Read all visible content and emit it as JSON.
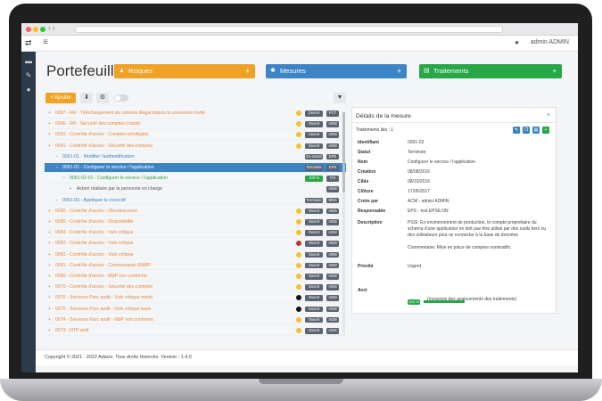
{
  "app": {
    "menu_icon": "hamburger-icon",
    "user_name": "admin ADMIN"
  },
  "page": {
    "title": "Portefeuille"
  },
  "categories": [
    {
      "label": "Risques",
      "color": "#f0a226",
      "icon": "warning-icon"
    },
    {
      "label": "Mesures",
      "color": "#3c84c6",
      "icon": "cogs-icon"
    },
    {
      "label": "Traitements",
      "color": "#27a745",
      "icon": "list-icon"
    }
  ],
  "toolbar": {
    "add_label": "+ Ajouter"
  },
  "tree": [
    {
      "text": "0097 - RR : Téléchargement de contenu illégal depuis la connexion invité",
      "color": "#e8883a",
      "indent": 0,
      "dot": "#f2c230",
      "badges": [
        "Ouvert",
        "PCT"
      ]
    },
    {
      "text": "0096 - RR : Sécurité des comptes (copie)",
      "color": "#e8883a",
      "indent": 0,
      "dot": "#f2c230",
      "badges": [
        "Ouvert",
        "ADM"
      ]
    },
    {
      "text": "0092 - Contrôle d'accès - Comptes privilégiés",
      "color": "#e8883a",
      "indent": 0,
      "dot": "#f2c230",
      "badges": [
        "Ouvert",
        "ADM"
      ]
    },
    {
      "text": "0091 - Contrôle d'accès - Sécurité des comptes",
      "color": "#e8883a",
      "indent": 0,
      "dot": "#f2c230",
      "badges": [
        "Ouvert",
        "ADM"
      ]
    },
    {
      "text": "0091-01 - Modifier l'authentification",
      "color": "#3c84c6",
      "indent": 1,
      "dot": "",
      "badges": [
        "En retard",
        "EPS"
      ]
    },
    {
      "text": "0091-02 - Configurer le service / l'application",
      "color": "#ffffff",
      "indent": 1,
      "dot": "",
      "badges": [
        "Terminée",
        "EPS"
      ],
      "selected": true
    },
    {
      "text": "0091-02-01 - Configurer le service / l'application",
      "color": "#27a745",
      "indent": 2,
      "dot": "",
      "badges": [
        "100 %",
        "THI"
      ]
    },
    {
      "text": "Action réalisée par la personne en charge",
      "color": "#555555",
      "indent": 3,
      "dot": "",
      "badges": [
        "ADM"
      ]
    },
    {
      "text": "0091-03 - Appliquer le correctif",
      "color": "#3c84c6",
      "indent": 1,
      "dot": "",
      "badges": [
        "Terminée",
        "BRO"
      ]
    },
    {
      "text": "0090 - Contrôle d'accès - Obsolescence",
      "color": "#e8883a",
      "indent": 0,
      "dot": "#f2c230",
      "badges": [
        "Ouvert",
        "ADM"
      ]
    },
    {
      "text": "0085 - Contrôle d'accès - Disponibilité",
      "color": "#e8883a",
      "indent": 0,
      "dot": "#f2c230",
      "badges": [
        "Ouvert",
        "ADM"
      ]
    },
    {
      "text": "0084 - Contrôle d'accès - Vuln critique",
      "color": "#e8883a",
      "indent": 0,
      "dot": "#f2c230",
      "badges": [
        "Ouvert",
        "ADM"
      ]
    },
    {
      "text": "0083 - Contrôle d'accès - Vuln critique",
      "color": "#e8883a",
      "indent": 0,
      "dot": "#c0392b",
      "badges": [
        "Ouvert",
        "ADM"
      ]
    },
    {
      "text": "0082 - Contrôle d'accès - Vuln critique",
      "color": "#e8883a",
      "indent": 0,
      "dot": "#f2c230",
      "badges": [
        "Ouvert",
        "ADM"
      ]
    },
    {
      "text": "0081 - Contrôle d'accès - Communauté SNMP",
      "color": "#e8883a",
      "indent": 0,
      "dot": "#f2c230",
      "badges": [
        "Ouvert",
        "ADM"
      ]
    },
    {
      "text": "0080 - Contrôle d'accès - MdP non conforme",
      "color": "#e8883a",
      "indent": 0,
      "dot": "#f2c230",
      "badges": [
        "Ouvert",
        "ADM"
      ]
    },
    {
      "text": "0079 - Contrôle d'accès - Sécurité des comptes",
      "color": "#e8883a",
      "indent": 0,
      "dot": "#f2c230",
      "badges": [
        "Ouvert",
        "ADM"
      ]
    },
    {
      "text": "0076 - Serveurs Parc audit - Vuln critique metal",
      "color": "#e8883a",
      "indent": 0,
      "dot": "#111111",
      "badges": [
        "Ouvert",
        "ADM"
      ]
    },
    {
      "text": "0075 - Serveurs Parc audit - Vuln critique bash",
      "color": "#e8883a",
      "indent": 0,
      "dot": "#111111",
      "badges": [
        "Ouvert",
        "ADM"
      ]
    },
    {
      "text": "0074 - Serveurs Parc audit - MdP non conforme",
      "color": "#e8883a",
      "indent": 0,
      "dot": "#f2c230",
      "badges": [
        "Ouvert",
        "ADM"
      ]
    },
    {
      "text": "0073 - NTP actif",
      "color": "#e8883a",
      "indent": 0,
      "dot": "#f2c230",
      "badges": [
        "Ouvert",
        "ADM"
      ]
    }
  ],
  "detail": {
    "title": "Détails de la mesure",
    "linked_label": "Traitements liés : 1",
    "fields": [
      {
        "key": "Identifiant",
        "value": "0091-02"
      },
      {
        "key": "Statut",
        "value": "Terminée"
      },
      {
        "key": "Nom",
        "value": "Configurer le service / l'application"
      },
      {
        "key": "Création",
        "value": "08/08/2016"
      },
      {
        "key": "Cible",
        "value": "08/10/2016"
      },
      {
        "key": "Clôture",
        "value": "17/05/2017"
      },
      {
        "key": "Créée par",
        "value": "ACM - admin ADMIN"
      },
      {
        "key": "Responsable",
        "value": "EPS - test EPSILON"
      },
      {
        "key": "Description",
        "value": "PSSI: En environnement de production, le compte propriétaire du schéma d'une application ne doit pas être utilisé par des outils tiers ou des utilisateurs pour se connecter à la base de données\n\nCommentaire: Mise en place de comptes nominatifs."
      },
      {
        "key": "Priorité",
        "value": "Urgent"
      },
      {
        "key": "Avct",
        "value": "(moyenne des avancements des traitements)"
      }
    ],
    "progress_label": "100 %",
    "progress": 1.0
  },
  "footer": {
    "text": "Copyright © 2021 - 2022 Adacis. Tous droits réservés. Version : 1.4.0"
  }
}
